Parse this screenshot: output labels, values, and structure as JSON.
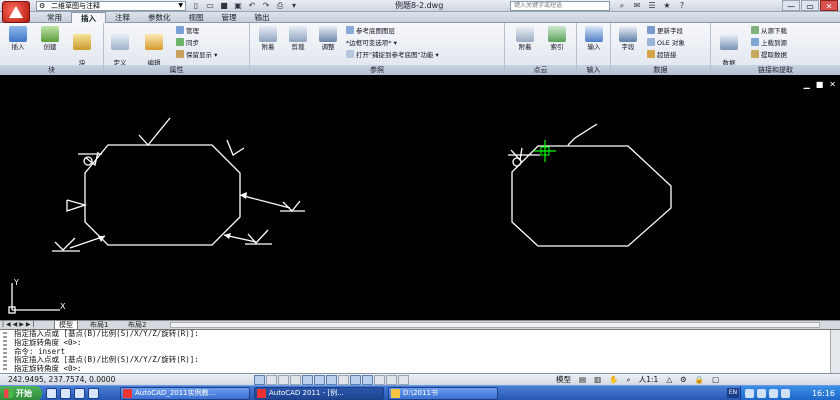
{
  "titlebar": {
    "workspace": "二维草图与注释",
    "document_title": "例题8-2.dwg",
    "search_placeholder": "键入关键字或短语"
  },
  "tabs": [
    "常用",
    "插入",
    "注释",
    "参数化",
    "视图",
    "管理",
    "输出"
  ],
  "active_tab": "插入",
  "ribbon": {
    "block_panel": {
      "title": "块",
      "buttons": [
        "插入",
        "创建",
        "块\n编辑器"
      ]
    },
    "attributes_panel": {
      "title": "属性",
      "buttons": [
        "定义\n属性",
        "编辑\n属性"
      ],
      "small": [
        "管理",
        "同步",
        "保留显示"
      ]
    },
    "reference_panel": {
      "title": "参照",
      "buttons": [
        "附着",
        "剪裁",
        "调整"
      ],
      "small": [
        "参考底图图层",
        "*边框可变选项*",
        "打开\"捕捉到参考底图\"功能"
      ]
    },
    "pointcloud_panel": {
      "title": "点云",
      "buttons": [
        "附着",
        "索引"
      ]
    },
    "import_panel": {
      "title": "输入",
      "buttons": [
        "输入"
      ]
    },
    "data_panel": {
      "title": "数据",
      "buttons": [
        "字段"
      ],
      "small": [
        "更新字段",
        "OLE 对象",
        "超链接"
      ]
    },
    "link_panel": {
      "title": "链接和提取",
      "buttons": [
        "数据\n链接"
      ],
      "small": [
        "从源下载",
        "上载到源",
        "提取数据"
      ]
    }
  },
  "layout_tabs": [
    "模型",
    "布局1",
    "布局2"
  ],
  "active_layout": "模型",
  "command_lines": [
    "指定插入点或 [基点(B)/比例(S)/X/Y/Z/旋转(R)]:",
    "指定旋转角度 <0>:",
    "命令: insert",
    "指定插入点或 [基点(B)/比例(S)/X/Y/Z/旋转(R)]:",
    "指定旋转角度 <0>:"
  ],
  "statusbar": {
    "coordinates": "242.9495, 237.7574, 0.0000",
    "model_label": "模型",
    "scale_label": "人1:1"
  },
  "taskbar": {
    "start_label": "开始",
    "tasks": [
      "AutoCAD_2011实例教...",
      "AutoCAD 2011 - [例...",
      "D:\\2011书"
    ],
    "language": "EN",
    "clock": "16:16"
  },
  "colors": {
    "drawing_bg": "#000000",
    "geometry": "#ffffff",
    "cursor": "#00ff00",
    "taskbar": "#2757b4"
  }
}
